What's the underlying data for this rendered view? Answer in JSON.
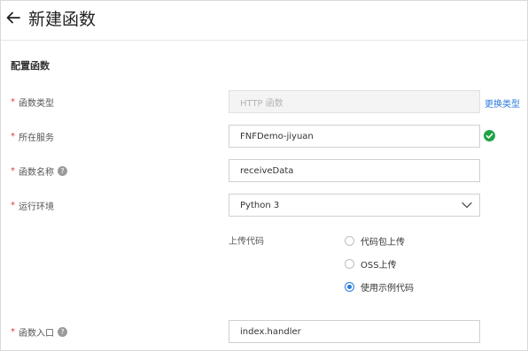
{
  "header": {
    "back_icon": "arrow-left-icon",
    "title": "新建函数"
  },
  "section": {
    "title": "配置函数"
  },
  "form": {
    "function_type": {
      "label": "函数类型",
      "value": "HTTP 函数",
      "switch_link": "更换类型"
    },
    "service": {
      "label": "所在服务",
      "value": "FNFDemo-jiyuan",
      "status_icon": "check-circle-icon"
    },
    "function_name": {
      "label": "函数名称",
      "help_icon": "question-circle-icon",
      "value": "receiveData"
    },
    "runtime": {
      "label": "运行环境",
      "value": "Python 3",
      "dropdown_icon": "chevron-down-icon"
    },
    "upload_code": {
      "label": "上传代码",
      "options": [
        "代码包上传",
        "OSS上传",
        "使用示例代码"
      ],
      "selected_index": 2
    },
    "entry": {
      "label": "函数入口",
      "help_icon": "question-circle-icon",
      "value": "index.handler"
    }
  },
  "colors": {
    "required": "#e4393c",
    "link": "#2a7bde",
    "success": "#1fa346",
    "radio_selected": "#2a7bde"
  }
}
